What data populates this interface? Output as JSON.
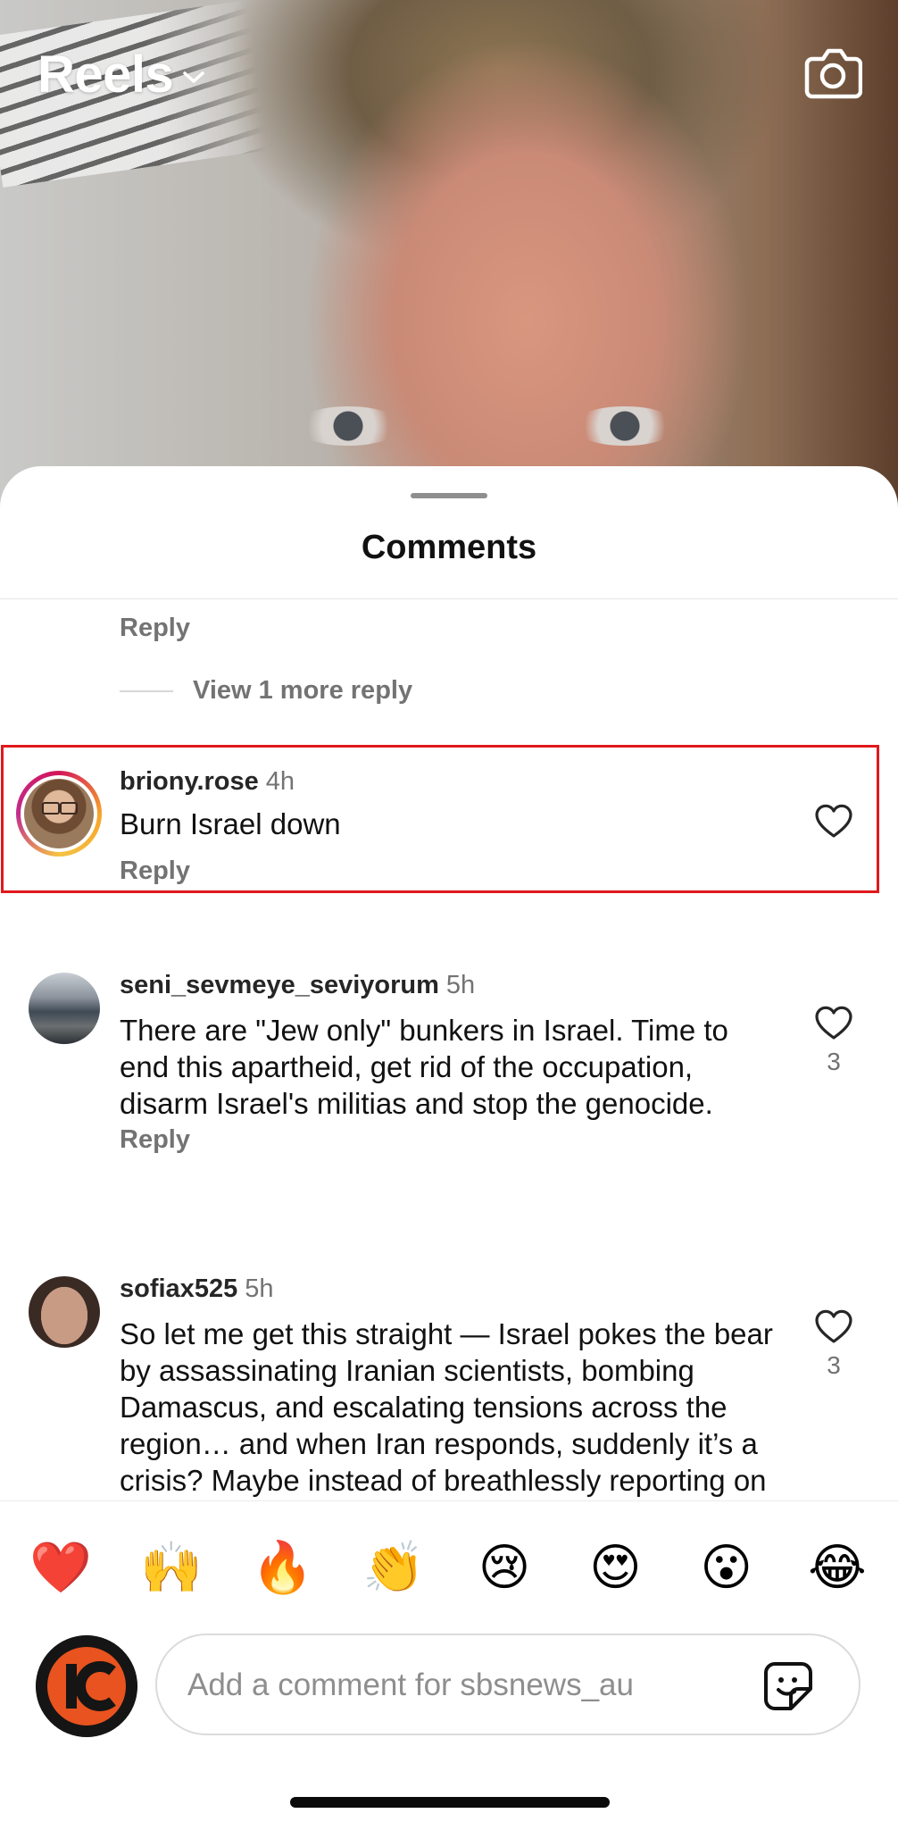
{
  "header": {
    "title": "Reels"
  },
  "sheet": {
    "title": "Comments"
  },
  "thread": {
    "reply_label": "Reply",
    "view_more": "View 1 more reply"
  },
  "comments": [
    {
      "username": "briony.rose",
      "time": "4h",
      "text": "Burn Israel down",
      "reply": "Reply",
      "likes": ""
    },
    {
      "username": "seni_sevmeye_seviyorum",
      "time": "5h",
      "text": "There are \"Jew only\" bunkers in Israel. Time to end this apartheid, get rid of the occupation, disarm Israel's militias and stop the genocide.",
      "reply": "Reply",
      "likes": "3"
    },
    {
      "username": "sofiax525",
      "time": "5h",
      "text": "So let me get this straight — Israel pokes the bear by assassinating Iranian scientists, bombing Damascus, and escalating tensions across the region… and when Iran responds, suddenly it’s a crisis? Maybe instead of breathlessly reporting on “Iranian",
      "reply": "",
      "likes": "3"
    }
  ],
  "reactions": [
    "❤️",
    "🙌",
    "🔥",
    "👏",
    "😢",
    "😍",
    "😮",
    "😂"
  ],
  "composer": {
    "placeholder": "Add a comment for sbsnews_au",
    "value": ""
  },
  "colors": {
    "highlight": "#e0191b",
    "muted_text": "#737373"
  },
  "icons": [
    "chevron-down-icon",
    "camera-icon",
    "heart-outline-icon",
    "sticker-icon"
  ]
}
